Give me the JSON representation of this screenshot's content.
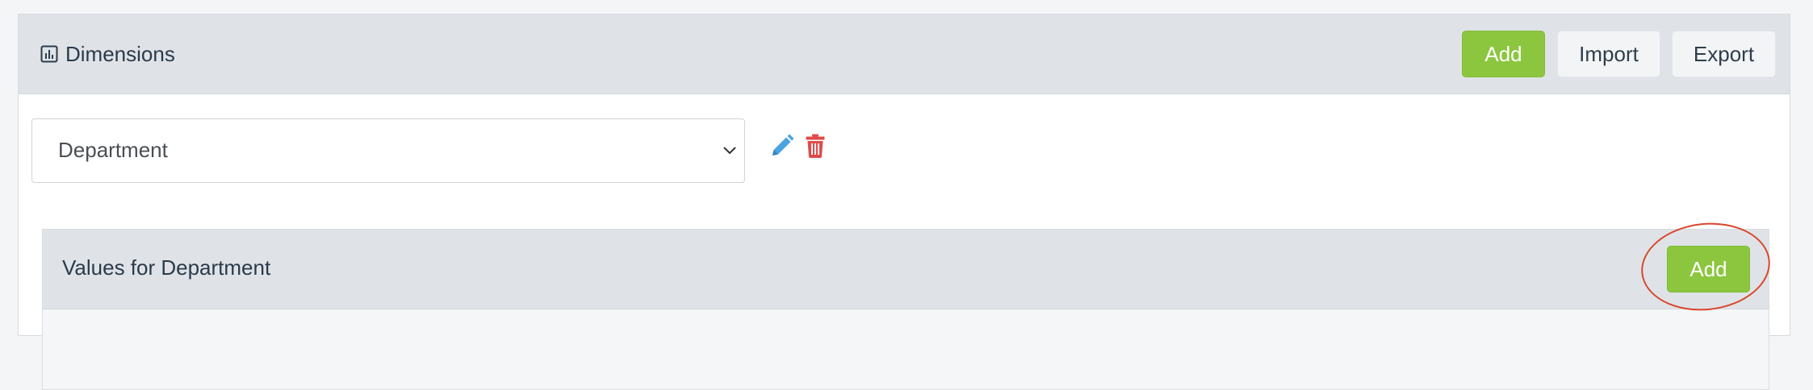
{
  "header": {
    "title": "Dimensions",
    "icon": "bar-chart-icon",
    "buttons": {
      "add": "Add",
      "import": "Import",
      "export": "Export"
    }
  },
  "dimension_select": {
    "selected": "Department"
  },
  "actions": {
    "edit_icon": "pencil-icon",
    "delete_icon": "trash-icon"
  },
  "values_panel": {
    "title": "Values for Department",
    "add_label": "Add"
  },
  "colors": {
    "accent_green": "#8cc63f",
    "edit_blue": "#4aa3df",
    "delete_red": "#e04b4b",
    "annotation_red": "#d9472b",
    "header_bg": "#dfe3e7"
  }
}
